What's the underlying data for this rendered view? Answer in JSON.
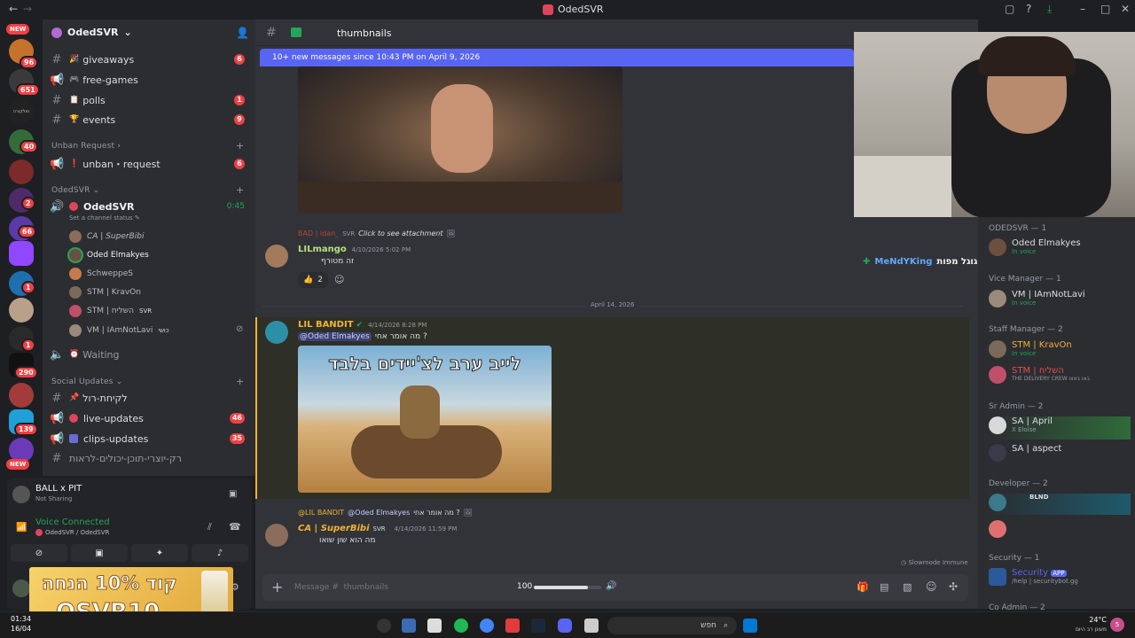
{
  "window": {
    "title": "OdedSVR"
  },
  "rail": {
    "new_label": "NEW",
    "badges": [
      "96",
      "651",
      "40",
      "2",
      "66",
      "1",
      "1",
      "290",
      "139",
      "4",
      "W",
      "46"
    ]
  },
  "server": {
    "name": "OdedSVR"
  },
  "channels": [
    {
      "icon": "🎉",
      "name": "giveaways",
      "badge": "6"
    },
    {
      "icon": "🎮",
      "name": "free-games",
      "badge": ""
    },
    {
      "icon": "📋",
      "name": "polls",
      "badge": "1"
    },
    {
      "icon": "🏆",
      "name": "events",
      "badge": "9"
    }
  ],
  "cat_unban": "Unban Request",
  "unban_channel": {
    "name": "unban・request",
    "badge": "6"
  },
  "cat_voice": "OdedSVR",
  "voice": {
    "name": "OdedSVR",
    "time": "0:45",
    "status": "Set a channel status"
  },
  "voice_users": [
    "CA | SuperBibi",
    "Oded Elmakyes",
    "SchweppeS",
    "STM | KravOn",
    "STM | השליח",
    "VM | IAmNotLavi"
  ],
  "svr_tag": "SVR",
  "koshi_tag": "כושי",
  "waiting": "Waiting",
  "cat_social": "Social Updates",
  "social": [
    {
      "name": "לקיחת-רול",
      "badge": ""
    },
    {
      "name": "live-updates",
      "badge": "46"
    },
    {
      "name": "clips-updates",
      "badge": "35"
    },
    {
      "name": "רק-יוצרי-תוכן-יכולים-לראות",
      "badge": ""
    }
  ],
  "user_panel": {
    "name": "BALL x PIT",
    "status": "Not Sharing",
    "voice_connected": "Voice Connected",
    "voice_path": "OdedSVR / OdedSVR"
  },
  "promo": {
    "line1": "קוד 10% הנחה",
    "line2": "OSVR10"
  },
  "channel_header": {
    "name": "thumbnails"
  },
  "new_messages": "10+ new messages since 10:43 PM on April 9, 2026",
  "messages": [
    {
      "reply_to": "BAD | idan_",
      "reply_tag": "SVR",
      "reply_text": "Click to see attachment",
      "author": "LILmango",
      "time": "4/10/2026 5:02 PM",
      "text": "זה מטורף",
      "reaction": "👍",
      "reaction_count": "2"
    },
    {
      "divider": "April 14, 2026"
    },
    {
      "author": "LIL BANDIT",
      "time": "4/14/2026 8:28 PM",
      "mention": "@Oded Elmakyes",
      "text": "מה אומר אחי ?",
      "image_caption": "לייב ערב לצ'יידים בלבד"
    },
    {
      "reply_to": "@LIL BANDIT",
      "reply_mention": "@Oded Elmakyes",
      "reply_text": "מה אומר אחי ?",
      "author": "CA | SuperBibi",
      "author_tag": "SVR",
      "time": "4/14/2026 11:59 PM",
      "text": "מה הוא שון שואו"
    }
  ],
  "slowmode": "Slowmode Immune",
  "composer": {
    "placeholder": "Message #  thumbnails",
    "volume": "100"
  },
  "volume_pct": 0.8,
  "overlay": {
    "author": "MeNdYKing",
    "text": "תעשה גוגל מפות"
  },
  "members": {
    "sections": [
      {
        "title": "ODEDSVR — 1",
        "users": [
          {
            "name": "Oded Elmakyes",
            "sub": "In voice",
            "color": "#dbdee1"
          }
        ]
      },
      {
        "title": "Vice Manager — 1",
        "users": [
          {
            "name": "VM | IAmNotLavi",
            "sub": "In voice",
            "color": "#dbdee1"
          }
        ]
      },
      {
        "title": "Staff Manager — 2",
        "users": [
          {
            "name": "STM | KravOn",
            "sub": "In voice",
            "color": "#f0b132"
          },
          {
            "name": "STM | השליח",
            "sub": "THE DELIVERY CREW באו באווו",
            "color": "#e05151"
          }
        ]
      },
      {
        "title": "Sr Admin — 2",
        "users": [
          {
            "name": "SA | April",
            "sub": "X Eloise",
            "color": "#dbdee1"
          },
          {
            "name": "SA | aspect",
            "sub": "",
            "color": "#dbdee1"
          }
        ]
      },
      {
        "title": "Developer — 2",
        "users": [
          {
            "name": "BLND",
            "sub": "",
            "color": "#dbdee1"
          },
          {
            "name": "",
            "sub": "",
            "color": "#5865f2"
          }
        ]
      },
      {
        "title": "Security — 1",
        "users": [
          {
            "name": "Security",
            "sub": "/help | securitybot.gg",
            "color": "#5865f2",
            "tag": "APP"
          }
        ]
      },
      {
        "title": "Co Admin — 2",
        "users": []
      }
    ]
  },
  "taskbar": {
    "search": "חפש",
    "time": "01:34",
    "date": "16/04",
    "weather": "24°C",
    "weather_sub": "מעונן רב היום",
    "notif": "5"
  }
}
